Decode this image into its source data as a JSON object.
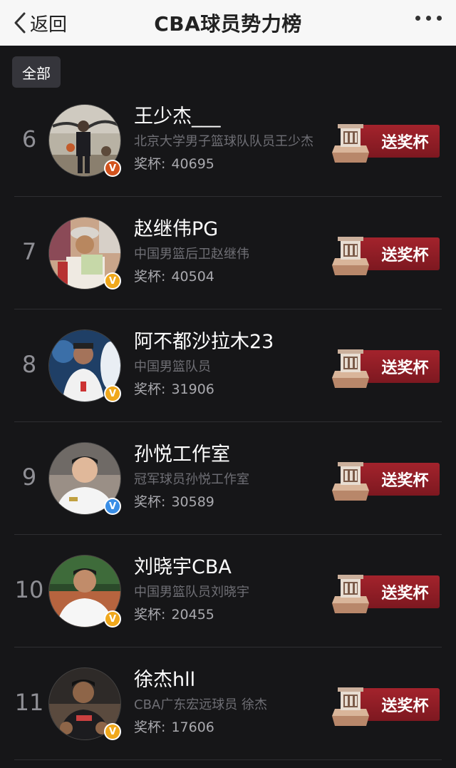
{
  "header": {
    "back_label": "返回",
    "title": "CBA球员势力榜"
  },
  "filter": {
    "label": "全部"
  },
  "players": [
    {
      "rank": "6",
      "name": "王少杰___",
      "desc": "北京大学男子篮球队队员王少杰",
      "cups_label": "奖杯:",
      "cups": "40695",
      "badge": "V",
      "badge_color": "#d2531e",
      "button": "送奖杯"
    },
    {
      "rank": "7",
      "name": "赵继伟PG",
      "desc": "中国男篮后卫赵继伟",
      "cups_label": "奖杯:",
      "cups": "40504",
      "badge": "V",
      "badge_color": "#f0a81c",
      "button": "送奖杯"
    },
    {
      "rank": "8",
      "name": "阿不都沙拉木23",
      "desc": "中国男篮队员",
      "cups_label": "奖杯:",
      "cups": "31906",
      "badge": "V",
      "badge_color": "#f0a81c",
      "button": "送奖杯"
    },
    {
      "rank": "9",
      "name": "孙悦工作室",
      "desc": "冠军球员孙悦工作室",
      "cups_label": "奖杯:",
      "cups": "30589",
      "badge": "V",
      "badge_color": "#3a8ee6",
      "button": "送奖杯"
    },
    {
      "rank": "10",
      "name": "刘晓宇CBA",
      "desc": "中国男篮队员刘晓宇",
      "cups_label": "奖杯:",
      "cups": "20455",
      "badge": "V",
      "badge_color": "#f0a81c",
      "button": "送奖杯"
    },
    {
      "rank": "11",
      "name": "徐杰hll",
      "desc": "CBA广东宏远球员 徐杰",
      "cups_label": "奖杯:",
      "cups": "17606",
      "badge": "V",
      "badge_color": "#f0a81c",
      "button": "送奖杯"
    }
  ],
  "colors": {
    "background": "#161618",
    "topbar": "#f7f7f7",
    "button": "#8e1d25"
  },
  "icons": {
    "back": "chevron-left-icon",
    "more": "more-dots-icon",
    "trophy": "trophy-icon",
    "verified": "verified-badge-icon"
  }
}
